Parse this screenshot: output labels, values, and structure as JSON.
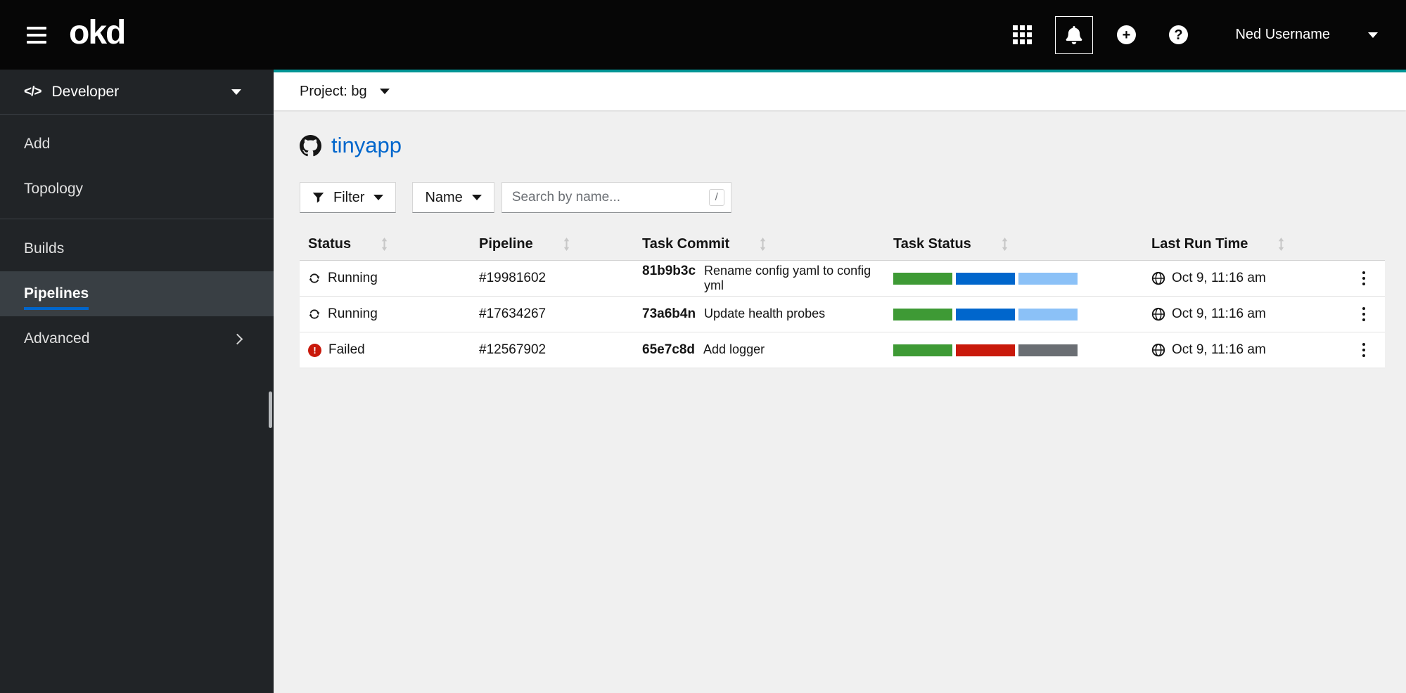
{
  "header": {
    "logo_text": "okd",
    "user_name": "Ned Username",
    "icons": {
      "menu": "hamburger-icon",
      "app_launcher": "grid-icon",
      "notifications": "bell-icon",
      "add_glyph": "+",
      "help_glyph": "?"
    }
  },
  "sidebar": {
    "perspective_label": "Developer",
    "items": [
      {
        "label": "Add",
        "active": false
      },
      {
        "label": "Topology",
        "active": false
      },
      {
        "label": "Builds",
        "active": false
      },
      {
        "label": "Pipelines",
        "active": true
      },
      {
        "label": "Advanced",
        "active": false
      }
    ]
  },
  "project_bar": {
    "label": "Project: bg"
  },
  "page": {
    "title": "tinyapp"
  },
  "toolbar": {
    "filter_label": "Filter",
    "attribute_label": "Name",
    "search_placeholder": "Search by name...",
    "search_shortcut": "/"
  },
  "table": {
    "columns": [
      "Status",
      "Pipeline",
      "Task Commit",
      "Task Status",
      "Last Run Time"
    ],
    "rows": [
      {
        "status": "Running",
        "status_type": "running",
        "pipeline": "#19981602",
        "commit_hash": "81b9b3c",
        "commit_message": "Rename config yaml to config yml",
        "bars": [
          "#3E9A35",
          "#0066CC",
          "#8BC1F7"
        ],
        "last_run": "Oct 9, 11:16 am"
      },
      {
        "status": "Running",
        "status_type": "running",
        "pipeline": "#17634267",
        "commit_hash": "73a6b4n",
        "commit_message": "Update health probes",
        "bars": [
          "#3E9A35",
          "#0066CC",
          "#8BC1F7"
        ],
        "last_run": "Oct 9, 11:16 am"
      },
      {
        "status": "Failed",
        "status_type": "failed",
        "pipeline": "#12567902",
        "commit_hash": "65e7c8d",
        "commit_message": "Add logger",
        "bars": [
          "#3E9A35",
          "#C9190B",
          "#6A6E73"
        ],
        "last_run": "Oct 9, 11:16 am"
      }
    ]
  },
  "colors": {
    "accent_teal": "#009596",
    "link_blue": "#0066CC",
    "failed_red": "#C9190B",
    "success_green": "#3E9A35",
    "running_blue": "#0066CC",
    "pending_light_blue": "#8BC1F7",
    "skipped_gray": "#6A6E73"
  }
}
